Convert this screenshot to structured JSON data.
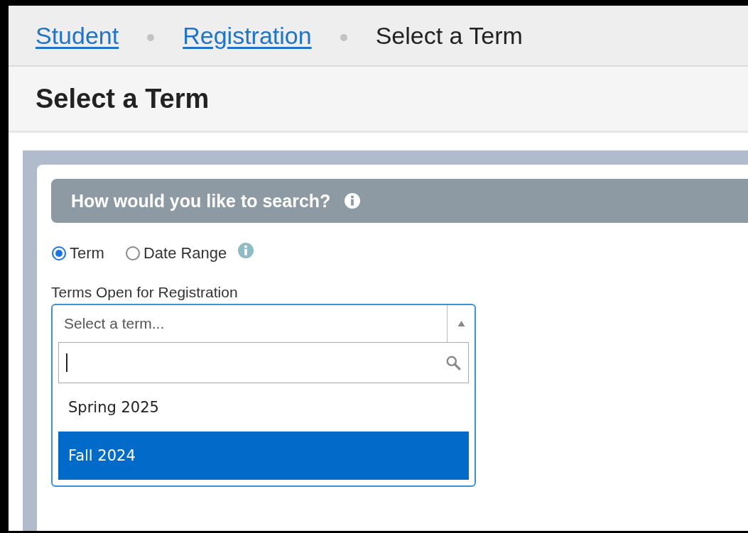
{
  "breadcrumb": [
    {
      "label": "Student",
      "kind": "link"
    },
    {
      "label": "Registration",
      "kind": "link"
    },
    {
      "label": "Select a Term",
      "kind": "current"
    }
  ],
  "page_title": "Select a Term",
  "search_panel": {
    "heading": "How would you like to search?",
    "options": [
      {
        "label": "Term",
        "selected": true
      },
      {
        "label": "Date Range",
        "selected": false
      }
    ],
    "field_label": "Terms Open for Registration",
    "select": {
      "placeholder": "Select a term...",
      "expanded": true,
      "items": [
        {
          "label": "Spring 2025",
          "selected": false
        },
        {
          "label": "Fall 2024",
          "selected": true
        }
      ]
    }
  }
}
